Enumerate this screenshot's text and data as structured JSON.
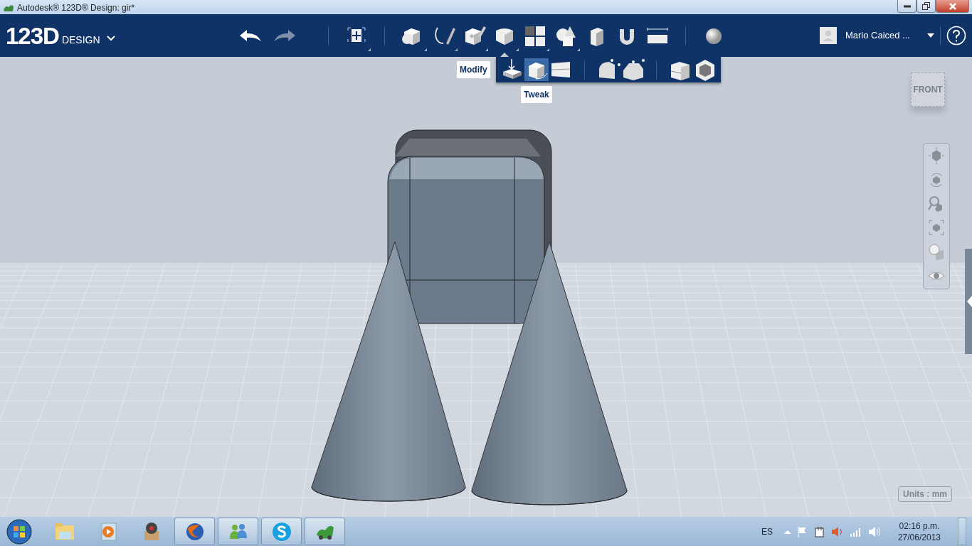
{
  "window": {
    "title": "Autodesk® 123D® Design: gir*"
  },
  "app_menu": {
    "logo": "123D",
    "product": "DESIGN"
  },
  "history": [
    {
      "kind": "undo",
      "disabled": false
    },
    {
      "kind": "redo",
      "disabled": true
    }
  ],
  "toolbar": [
    {
      "kind": "transform",
      "has_menu": true,
      "expanded": false
    },
    {
      "kind": "primitives",
      "has_menu": true,
      "expanded": false
    },
    {
      "kind": "sketch",
      "has_menu": true,
      "expanded": false
    },
    {
      "kind": "construct",
      "has_menu": true,
      "expanded": false
    },
    {
      "kind": "modify",
      "has_menu": true,
      "expanded": true
    },
    {
      "kind": "pattern",
      "has_menu": true,
      "expanded": false
    },
    {
      "kind": "grouping",
      "has_menu": true,
      "expanded": false
    },
    {
      "kind": "combine",
      "has_menu": false,
      "expanded": false
    },
    {
      "kind": "snap",
      "has_menu": false,
      "expanded": false
    },
    {
      "kind": "measure",
      "has_menu": false,
      "expanded": false
    },
    {
      "kind": "material",
      "has_menu": false,
      "expanded": false
    }
  ],
  "submenu": {
    "label": "Modify",
    "hover_label": "Tweak",
    "groups": [
      [
        {
          "kind": "presspull",
          "selected": false
        },
        {
          "kind": "tweak",
          "selected": true
        },
        {
          "kind": "splitface",
          "selected": false
        }
      ],
      [
        {
          "kind": "fillet",
          "selected": false
        },
        {
          "kind": "chamfer",
          "selected": false
        }
      ],
      [
        {
          "kind": "splitsolid",
          "selected": false
        },
        {
          "kind": "shell",
          "selected": false
        }
      ]
    ]
  },
  "user": {
    "name": "Mario Caiced ..."
  },
  "view_cube": {
    "face": "FRONT"
  },
  "nav_tools": [
    {
      "kind": "pan"
    },
    {
      "kind": "orbit"
    },
    {
      "kind": "zoom"
    },
    {
      "kind": "fit"
    },
    {
      "kind": "material_view"
    },
    {
      "kind": "visibility"
    }
  ],
  "units": "Units : mm",
  "taskbar": {
    "apps": [
      {
        "kind": "folder",
        "open": false
      },
      {
        "kind": "media",
        "open": false
      },
      {
        "kind": "box",
        "open": false
      },
      {
        "kind": "browser",
        "open": true
      },
      {
        "kind": "messenger",
        "open": true
      },
      {
        "kind": "skype",
        "open": true
      },
      {
        "kind": "design",
        "open": true
      }
    ],
    "language": "ES",
    "time": "02:16 p.m.",
    "date": "27/06/2013"
  }
}
